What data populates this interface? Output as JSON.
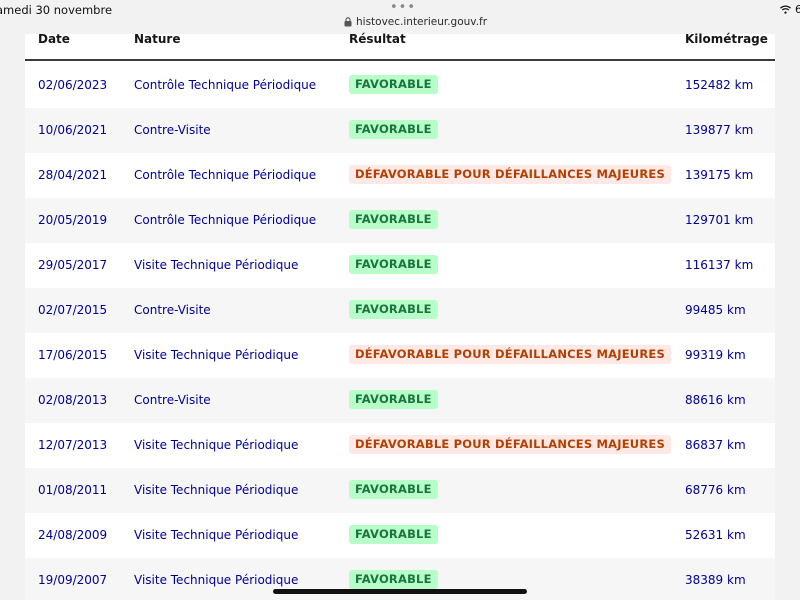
{
  "status_bar": {
    "time": "amedi 30 novembre",
    "dots": "•••",
    "url": "histovec.interieur.gouv.fr",
    "right": "6"
  },
  "table": {
    "headers": {
      "date": "Date",
      "nature": "Nature",
      "result": "Résultat",
      "km": "Kilométrage"
    },
    "rows": [
      {
        "date": "02/06/2023",
        "nature": "Contrôle Technique Périodique",
        "result": "FAVORABLE",
        "status": "fav",
        "km": "152482 km"
      },
      {
        "date": "10/06/2021",
        "nature": "Contre-Visite",
        "result": "FAVORABLE",
        "status": "fav",
        "km": "139877 km"
      },
      {
        "date": "28/04/2021",
        "nature": "Contrôle Technique Périodique",
        "result": "DÉFAVORABLE POUR DÉFAILLANCES MAJEURES",
        "status": "defav",
        "km": "139175 km"
      },
      {
        "date": "20/05/2019",
        "nature": "Contrôle Technique Périodique",
        "result": "FAVORABLE",
        "status": "fav",
        "km": "129701 km"
      },
      {
        "date": "29/05/2017",
        "nature": "Visite Technique Périodique",
        "result": "FAVORABLE",
        "status": "fav",
        "km": "116137 km"
      },
      {
        "date": "02/07/2015",
        "nature": "Contre-Visite",
        "result": "FAVORABLE",
        "status": "fav",
        "km": "99485 km"
      },
      {
        "date": "17/06/2015",
        "nature": "Visite Technique Périodique",
        "result": "DÉFAVORABLE POUR DÉFAILLANCES MAJEURES",
        "status": "defav",
        "km": "99319 km"
      },
      {
        "date": "02/08/2013",
        "nature": "Contre-Visite",
        "result": "FAVORABLE",
        "status": "fav",
        "km": "88616 km"
      },
      {
        "date": "12/07/2013",
        "nature": "Visite Technique Périodique",
        "result": "DÉFAVORABLE POUR DÉFAILLANCES MAJEURES",
        "status": "defav",
        "km": "86837 km"
      },
      {
        "date": "01/08/2011",
        "nature": "Visite Technique Périodique",
        "result": "FAVORABLE",
        "status": "fav",
        "km": "68776 km"
      },
      {
        "date": "24/08/2009",
        "nature": "Visite Technique Périodique",
        "result": "FAVORABLE",
        "status": "fav",
        "km": "52631 km"
      },
      {
        "date": "19/09/2007",
        "nature": "Visite Technique Périodique",
        "result": "FAVORABLE",
        "status": "fav",
        "km": "38389 km"
      }
    ]
  },
  "colors": {
    "link_blue": "#000091",
    "fav_bg": "#b8fec9",
    "fav_text": "#18753c",
    "defav_bg": "#fee9e6",
    "defav_text": "#b34000"
  }
}
